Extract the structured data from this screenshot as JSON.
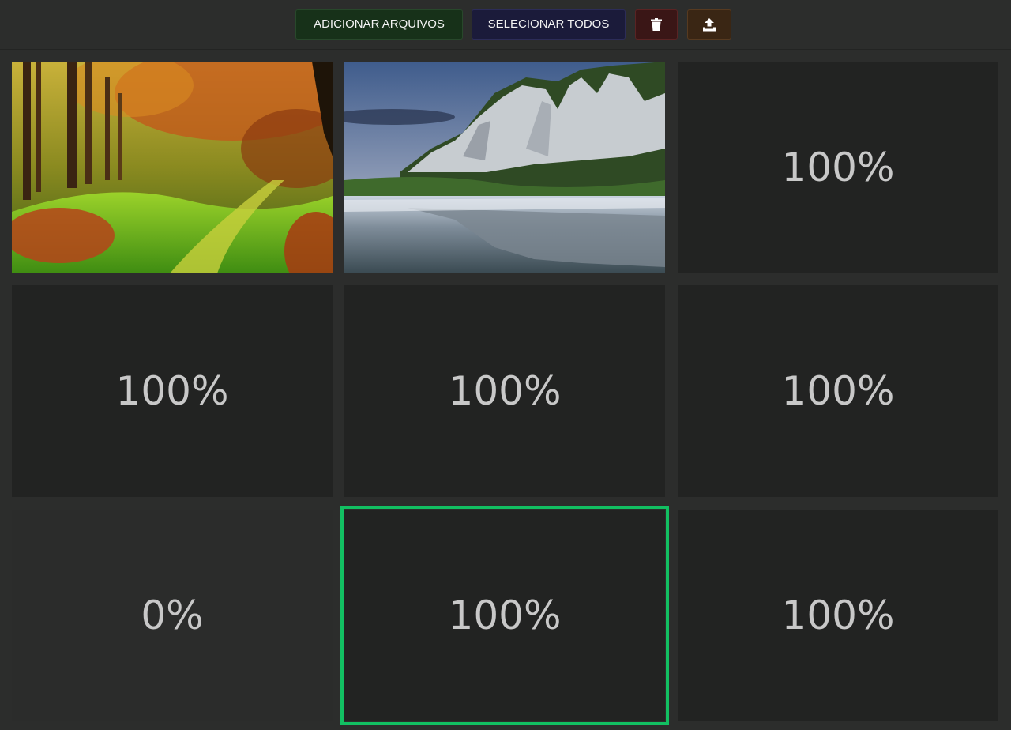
{
  "toolbar": {
    "add_files_label": "ADICIONAR ARQUIVOS",
    "select_all_label": "SELECIONAR TODOS",
    "delete_icon": "trash-icon",
    "upload_icon": "upload-icon"
  },
  "gallery": {
    "items": [
      {
        "kind": "image",
        "subject": "autumn-forest-path"
      },
      {
        "kind": "image",
        "subject": "white-cliffs-lake-reflection"
      },
      {
        "kind": "progress",
        "progress": "100%"
      },
      {
        "kind": "progress",
        "progress": "100%"
      },
      {
        "kind": "progress",
        "progress": "100%"
      },
      {
        "kind": "progress",
        "progress": "100%"
      },
      {
        "kind": "progress",
        "progress": "0%"
      },
      {
        "kind": "progress",
        "progress": "100%",
        "selected": true
      },
      {
        "kind": "progress",
        "progress": "100%"
      }
    ]
  },
  "colors": {
    "background": "#2c2d2c",
    "tile": "#222322",
    "selected_outline": "#12bf62",
    "add_button": "#173119",
    "select_button": "#1b1b3a",
    "delete_button": "#3a1616",
    "upload_button": "#3a2614"
  }
}
